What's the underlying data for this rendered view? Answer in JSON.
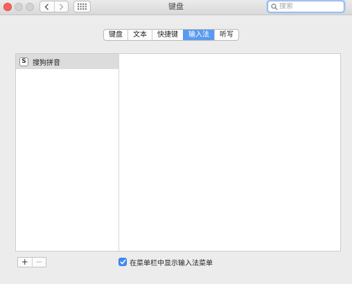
{
  "window": {
    "title": "键盘"
  },
  "toolbar": {
    "back_icon": "chevron-left-icon",
    "forward_icon": "chevron-right-icon",
    "show_all_icon": "grid-icon",
    "search_placeholder": "搜索",
    "search_value": ""
  },
  "tabs": [
    {
      "label": "键盘",
      "active": false
    },
    {
      "label": "文本",
      "active": false
    },
    {
      "label": "快捷键",
      "active": false
    },
    {
      "label": "输入法",
      "active": true
    },
    {
      "label": "听写",
      "active": false
    }
  ],
  "input_sources": {
    "items": [
      {
        "label": "搜狗拼音",
        "icon": "sogou-icon",
        "selected": true
      }
    ]
  },
  "bottom": {
    "add_label": "+",
    "remove_label": "−",
    "show_menu_checkbox": {
      "label": "在菜单栏中显示输入法菜单",
      "checked": true
    }
  },
  "colors": {
    "accent": "#5a9bf0",
    "close_button": "#fc605c",
    "checkbox": "#3f8df1",
    "window_bg": "#ececec"
  }
}
